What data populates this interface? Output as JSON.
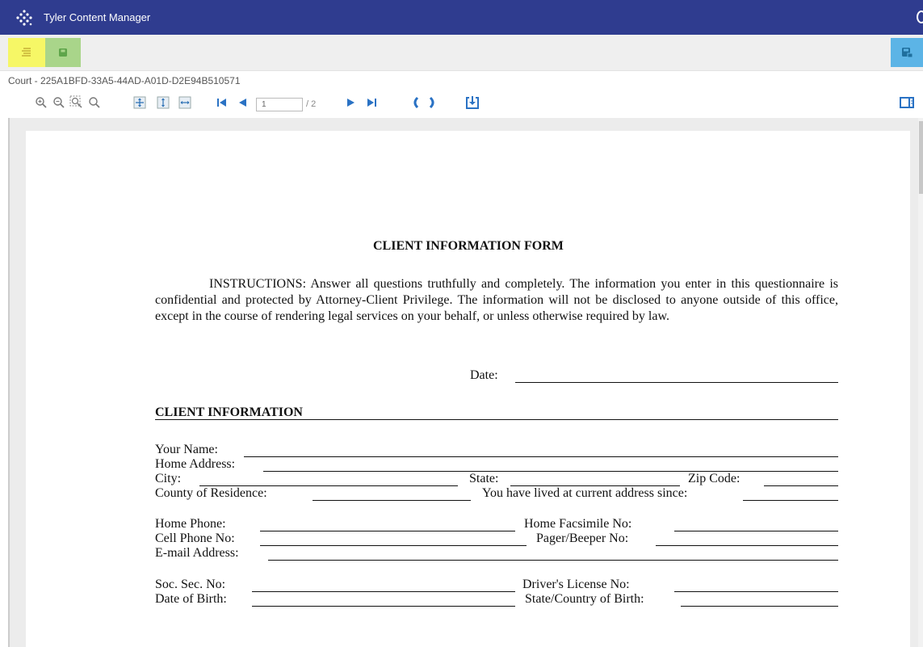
{
  "app": {
    "title": "Tyler Content Manager",
    "colors": {
      "titlebar": "#2f3c8f",
      "menu_button": "#f6f766",
      "save_button": "#a9d58a",
      "right_button": "#5cb4e6"
    }
  },
  "toolbar": {
    "menu_icon": "menu-lines-icon",
    "save_icon": "floppy-disk-icon",
    "right_icon": "save-options-icon"
  },
  "document": {
    "id_label": "Court - 225A1BFD-33A5-44AD-A01D-D2E94B510571",
    "current_page": "1",
    "page_count": "/ 2"
  },
  "viewer_tools": {
    "icons": [
      "zoom-in-icon",
      "zoom-out-icon",
      "zoom-marquee-icon",
      "zoom-search-icon",
      "fit-page-icon",
      "fit-height-icon",
      "fit-width-icon",
      "first-page-icon",
      "previous-page-icon",
      "next-page-icon",
      "last-page-icon",
      "rotate-left-icon",
      "rotate-right-icon",
      "download-icon",
      "sidebar-panel-icon"
    ]
  },
  "form": {
    "title": "CLIENT INFORMATION FORM",
    "instructions": "INSTRUCTIONS: Answer all questions truthfully and completely. The information you enter in this questionnaire is confidential and protected by Attorney-Client Privilege. The information will not be disclosed to anyone outside of this office, except in the course of rendering legal services on your behalf, or unless otherwise required by law.",
    "date_label": "Date:",
    "section_heading": "CLIENT INFORMATION",
    "fields": {
      "your_name": "Your Name:",
      "home_address": "Home Address:",
      "city": "City:",
      "state": "State:",
      "zip": "Zip Code:",
      "county": "County of Residence:",
      "lived_since": "You have lived at current address since:",
      "home_phone": "Home Phone:",
      "home_fax": "Home Facsimile No:",
      "cell_phone": "Cell Phone No:",
      "pager": "Pager/Beeper No:",
      "email": "E-mail Address:",
      "ssn": "Soc. Sec. No:",
      "drivers_license": "Driver's License No:",
      "dob": "Date of Birth:",
      "birth_place": "State/Country of Birth:"
    }
  }
}
